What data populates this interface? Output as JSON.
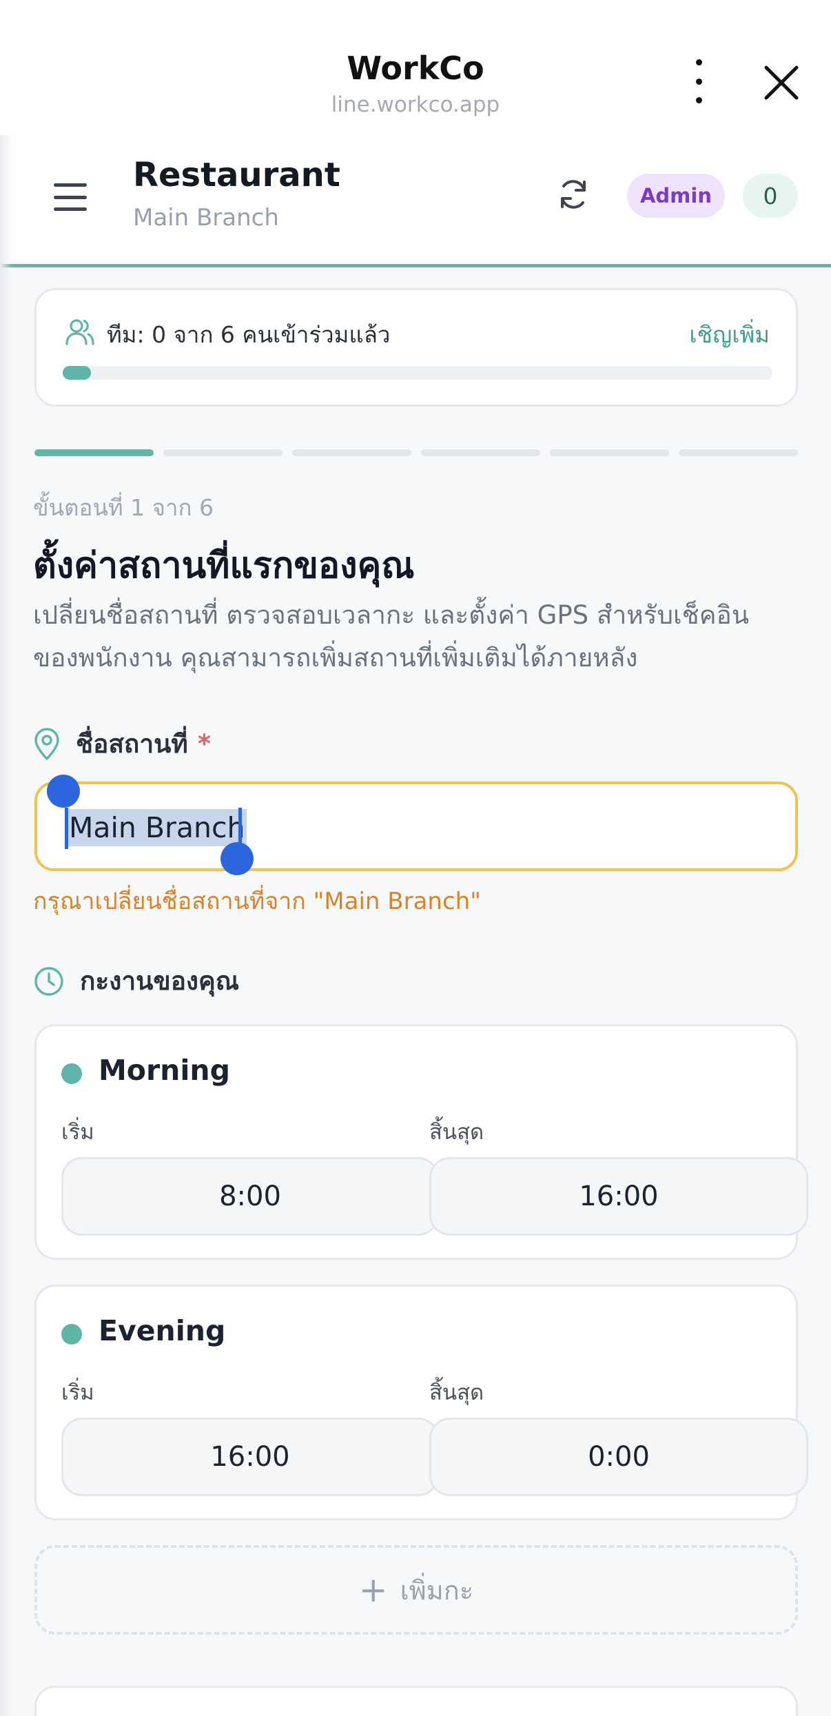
{
  "browser": {
    "title": "WorkCo",
    "url": "line.workco.app"
  },
  "header": {
    "store_name": "Restaurant",
    "branch_name": "Main Branch",
    "role_badge": "Admin",
    "count_badge": "0"
  },
  "team": {
    "status_text": "ทีม: 0 จาก 6 คนเข้าร่วมแล้ว",
    "invite_label": "เชิญเพิ่ม",
    "progress": 0.02
  },
  "wizard": {
    "total_steps": 6,
    "current_step": 1,
    "step_label": "ขั้นตอนที่ 1 จาก 6",
    "heading": "ตั้งค่าสถานที่แรกของคุณ",
    "description_line1": "เปลี่ยนชื่อสถานที่ ตรวจสอบเวลากะ และตั้งค่า GPS สำหรับเช็คอิน",
    "description_line2": "ของพนักงาน คุณสามารถเพิ่มสถานที่เพิ่มเติมได้ภายหลัง"
  },
  "location_field": {
    "label": "ชื่อสถานที่",
    "required_mark": "*",
    "value": "Main Branch",
    "warning": "กรุณาเปลี่ยนชื่อสถานที่จาก \"Main Branch\""
  },
  "shifts_section": {
    "label": "กะงานของคุณ",
    "start_label": "เริ่ม",
    "end_label": "สิ้นสุด",
    "add_label": "เพิ่มกะ",
    "items": [
      {
        "name": "Morning",
        "start": "8:00",
        "end": "16:00"
      },
      {
        "name": "Evening",
        "start": "16:00",
        "end": "0:00"
      }
    ]
  },
  "colors": {
    "accent": "#5fb5a7",
    "warning": "#d9822b",
    "input_focus_border": "#f0c24f",
    "selection_handle": "#2c66de",
    "admin_badge_bg": "#efe3fb",
    "admin_badge_text": "#7c3bc4"
  },
  "icons": {
    "menu": "menu-icon",
    "refresh": "refresh-icon",
    "more": "more-vertical-icon",
    "close": "close-icon",
    "team": "users-icon",
    "location": "map-pin-icon",
    "clock": "clock-icon",
    "plus": "plus-icon"
  }
}
